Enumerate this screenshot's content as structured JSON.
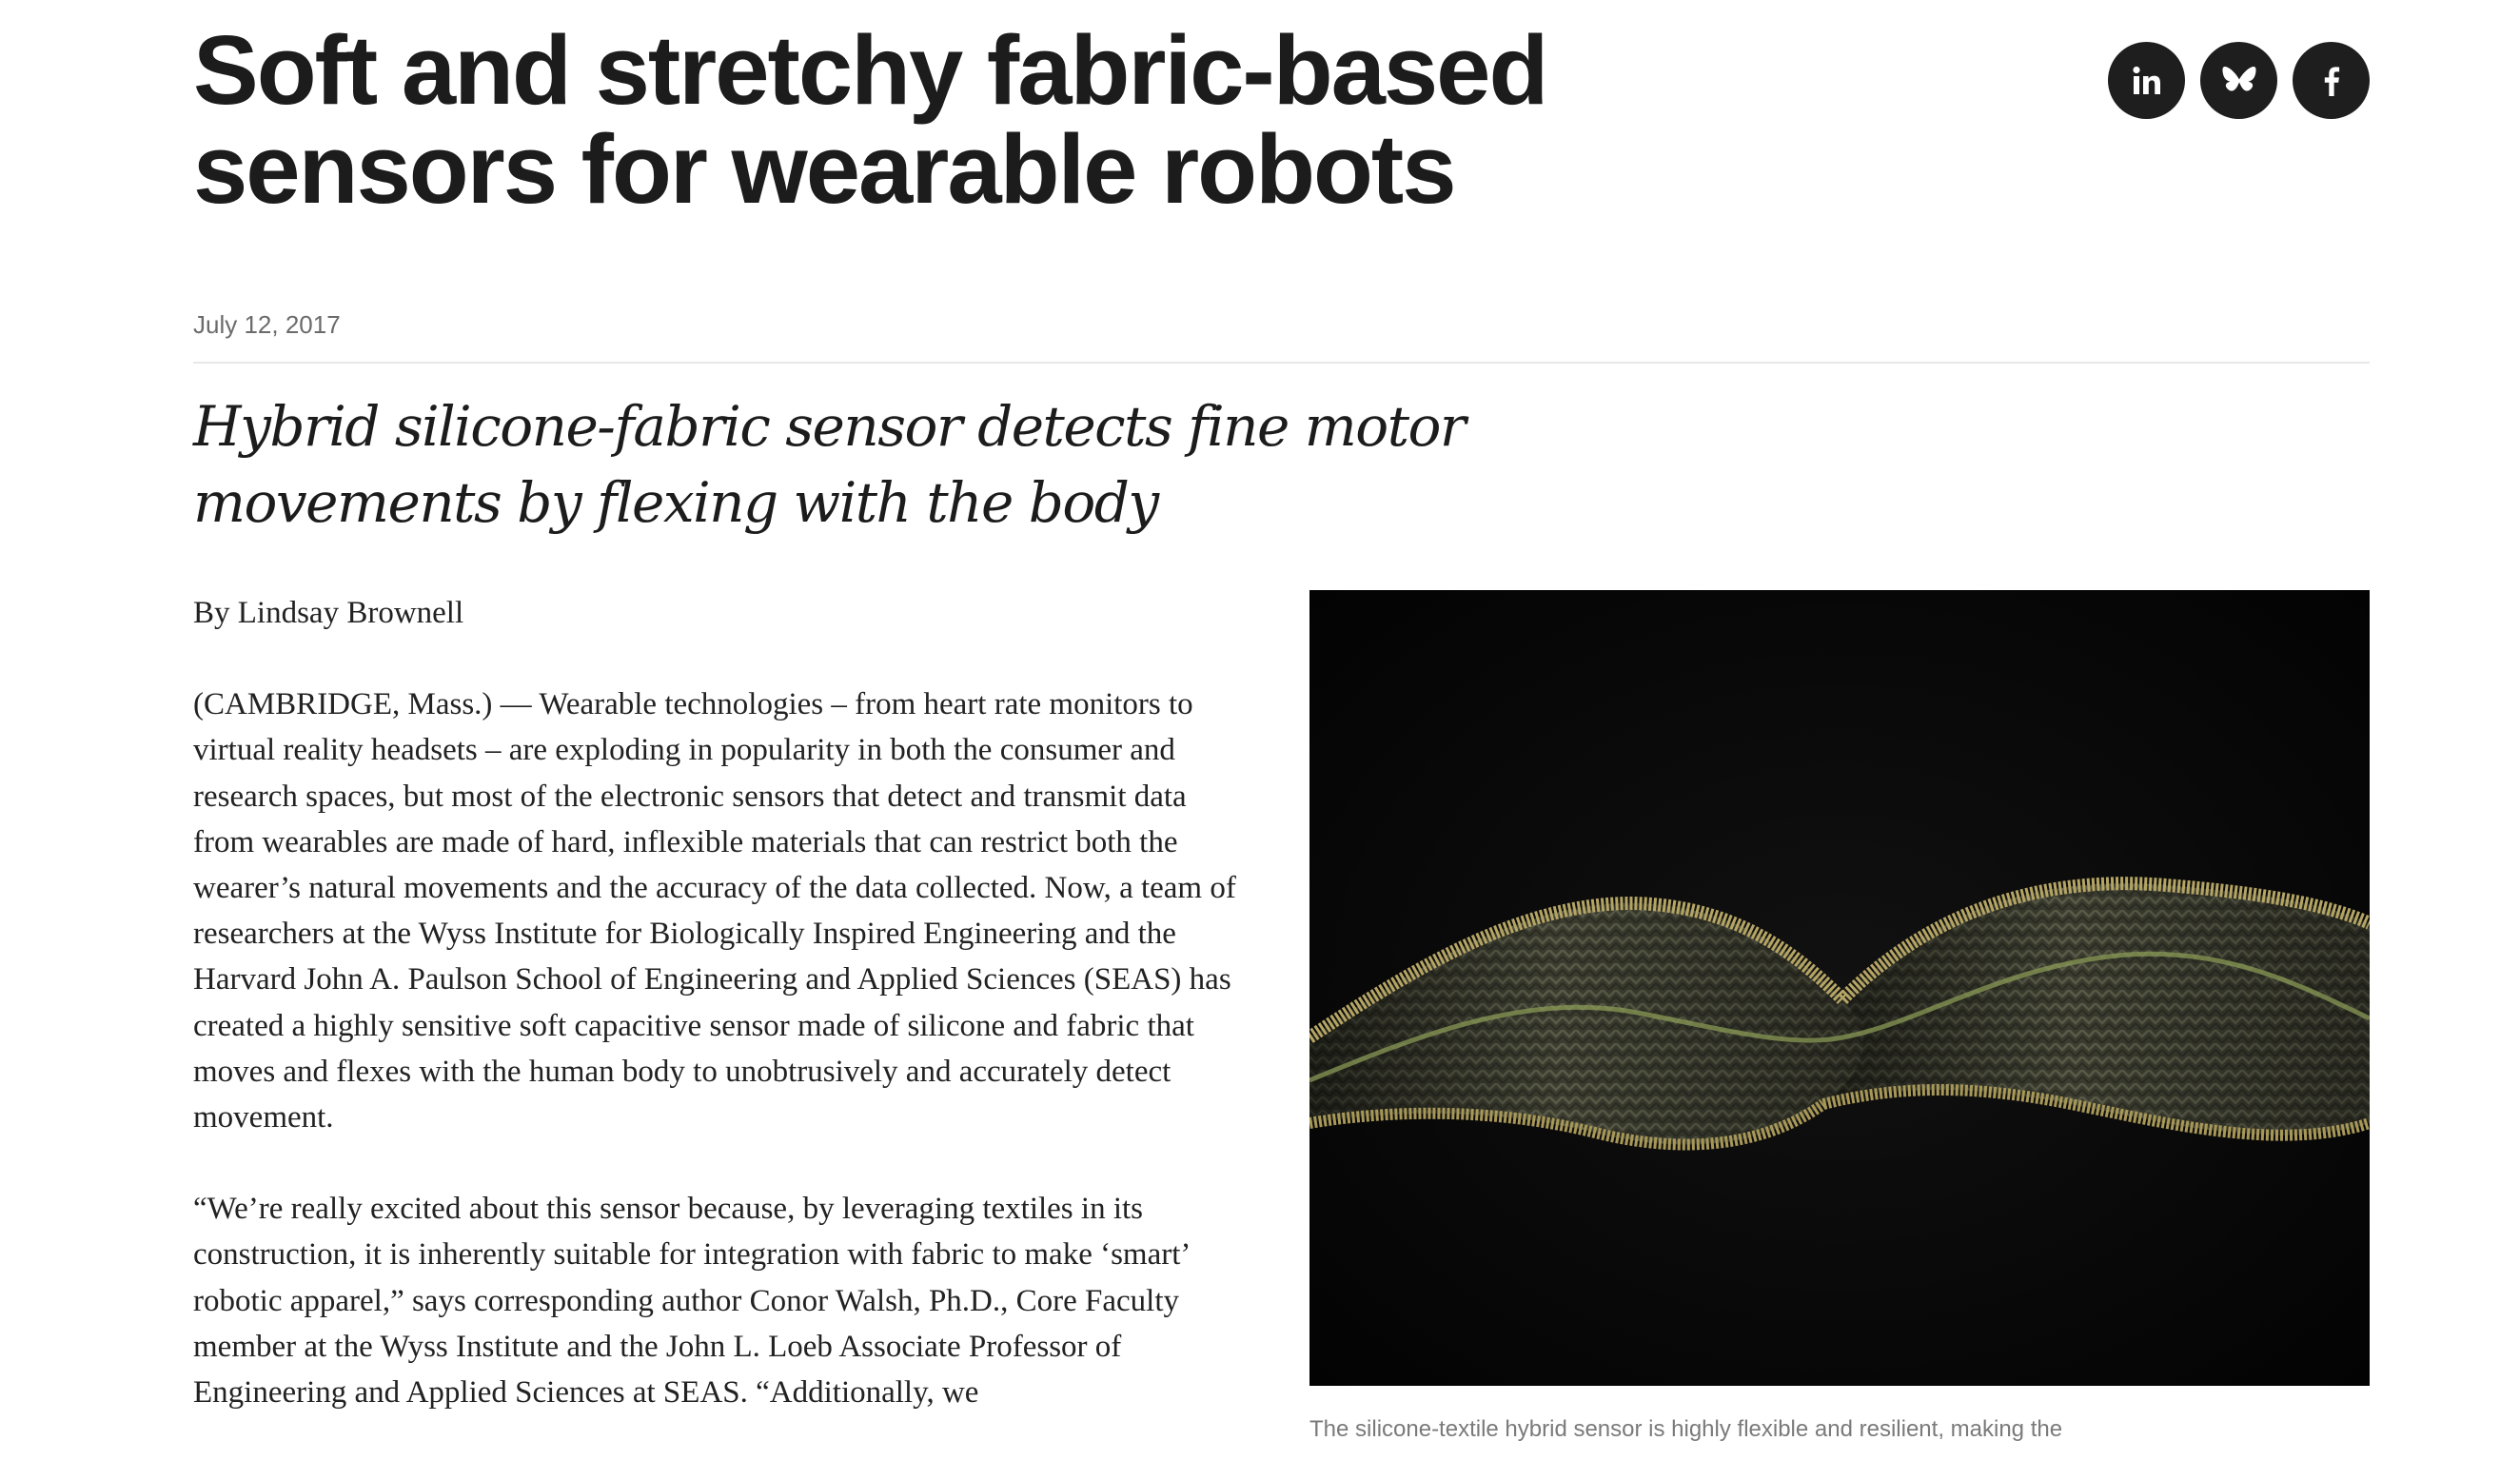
{
  "article": {
    "title": "Soft and stretchy fabric-based sensors for wearable robots",
    "date": "July 12, 2017",
    "subtitle": "Hybrid silicone-fabric sensor detects fine motor movements by flexing with the body",
    "byline": "By Lindsay Brownell",
    "paragraphs": [
      "(CAMBRIDGE, Mass.) — Wearable technologies – from heart rate monitors to virtual reality headsets – are exploding in popularity in both the consumer and research spaces, but most of the electronic sensors that detect and transmit data from wearables are made of hard, inflexible materials that can restrict both the wearer’s natural movements and the accuracy of the data collected. Now, a team of researchers at the Wyss Institute for Biologically Inspired Engineering and the Harvard John A. Paulson School of Engineering and Applied Sciences (SEAS) has created a highly sensitive soft capacitive sensor made of silicone and fabric that moves and flexes with the human body to unobtrusively and accurately detect movement.",
      "“We’re really excited about this sensor because, by leveraging textiles in its construction, it is inherently suitable for integration with fabric to make ‘smart’ robotic apparel,” says corresponding author Conor Walsh, Ph.D., Core Faculty member at the Wyss Institute and the John L. Loeb Associate Professor of Engineering and Applied Sciences at SEAS. “Additionally, we"
    ]
  },
  "share": {
    "linkedin_icon": "linkedin-icon",
    "bluesky_icon": "bluesky-icon",
    "facebook_icon": "facebook-icon",
    "linkedin_label": "in",
    "facebook_label": "f"
  },
  "figure": {
    "image_subject": "twisted silicone-textile sensor ribbon on black background",
    "caption": "The silicone-textile hybrid sensor is highly flexible and resilient, making the"
  },
  "colors": {
    "share_button_bg": "#1e1e1e",
    "text": "#1c1c1c",
    "date": "#6b6b6b",
    "divider": "#e8e8e8",
    "photo_bg": "#050505"
  }
}
